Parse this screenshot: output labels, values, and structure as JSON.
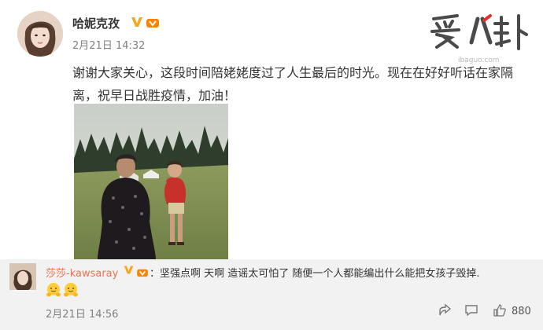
{
  "post": {
    "username": "哈妮克孜",
    "time": "2月21日 14:32",
    "text": "谢谢大家关心，这段时间陪姥姥度过了人生最后的时光。现在在好好听话在家隔离，祝早日战胜疫情，加油！"
  },
  "watermark": {
    "logo": "爱八卦",
    "url": "ibaguo.com"
  },
  "comment": {
    "username": "莎莎-kawsaray",
    "text": "：坚强点啊 天啊 造谣太可怕了 随便一个人都能编出什么能把女孩子毁掉.",
    "time": "2月21日 14:56",
    "like_count": "880"
  },
  "icons": {
    "verified": "verified-v-icon",
    "vip": "vip-badge-icon",
    "share": "share-icon",
    "comment": "comment-icon",
    "like": "thumbs-up-icon"
  },
  "colors": {
    "verified": "#f5a623",
    "vip": "#ff8200",
    "comment_name": "#eb7350",
    "comment_bg": "#f2f2f2"
  }
}
